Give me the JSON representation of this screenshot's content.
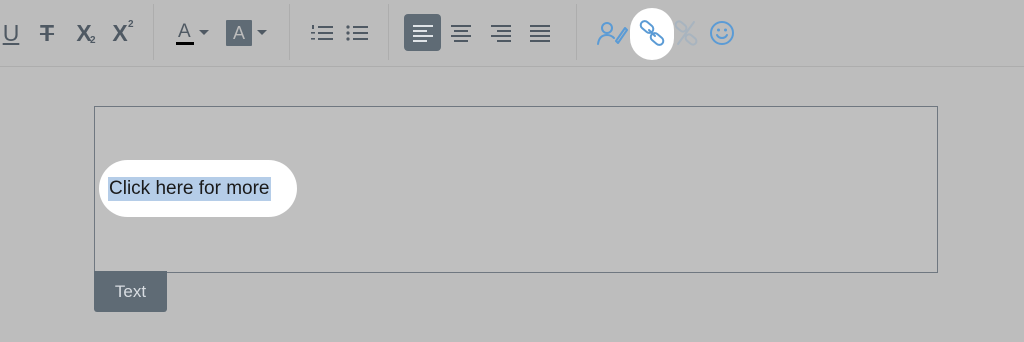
{
  "toolbar": {
    "underline_label": "U",
    "strike_label": "T",
    "subscript_label": "X",
    "subscript_mark": "2",
    "superscript_label": "X",
    "superscript_mark": "2",
    "font_color_label": "A",
    "bg_color_label": "A",
    "active_alignment": "left",
    "highlighted_tool": "link"
  },
  "editor": {
    "selected_text": "Click here for more",
    "block_type_label": "Text"
  },
  "colors": {
    "toolbar_icon": "#4f5963",
    "link_icon": "#5b9bd5",
    "selection": "#b5cde8",
    "tab_bg": "#5f6b75",
    "highlight": "#ffffff"
  }
}
